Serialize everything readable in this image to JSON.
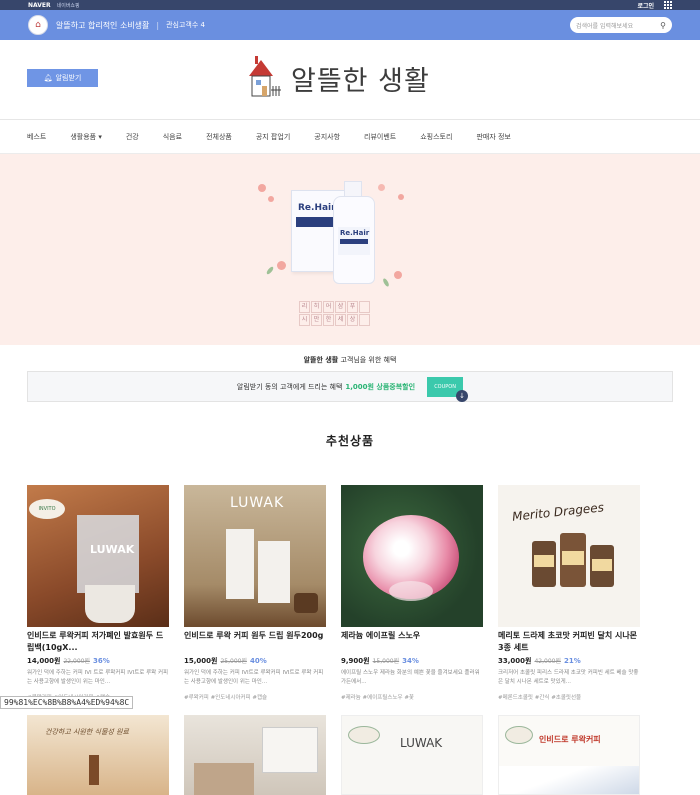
{
  "global": {
    "logo": "NAVER",
    "sub": "네이버쇼핑",
    "login": "로그인"
  },
  "store": {
    "tagline": "알뜰하고 합리적인 소비생활",
    "fans": "관심고객수 4",
    "search_placeholder": "검색어를 입력해보세요"
  },
  "header": {
    "alarm_label": "알림받기",
    "brand_name": "알뜰한 생활"
  },
  "nav": [
    "베스트",
    "생활용품",
    "건강",
    "식음료",
    "전체상품",
    "공지 팝업기",
    "공지사항",
    "리뷰이벤트",
    "쇼핑스토리",
    "판매자 정보"
  ],
  "hero": {
    "product_label": "Re.Hair",
    "tagline_chars": [
      "리",
      "히",
      "어",
      "샴",
      "푸",
      "",
      "시",
      "만",
      "한",
      "세",
      "상",
      ""
    ]
  },
  "benefit": {
    "title_bold": "알뜰한 생활",
    "title_rest": "고객님을 위한 혜택",
    "coupon_text": "알림받기 동의 고객에게 드리는 혜택",
    "coupon_amount": "1,000원 상품중복할인",
    "coupon_badge": "COUPON"
  },
  "recommended_title": "추천상품",
  "products": [
    {
      "title": "인비드로 루왁커피 저가폐인 발효원두 드립백(10gX...",
      "price": "14,000원",
      "orig": "22,000원",
      "disc": "36%",
      "desc": "워가인 덕에 주하는 커피 IVI 트로 루왁커피 IVI트로 루왁 커피는 사용고향에 발생인이 위는 마인...",
      "tags": "#루왁커피 #인도네시아커피 #캡슐",
      "img_label": "LUWAK"
    },
    {
      "title": "인비드로 루왁 커피 원두 드립 원두200g",
      "price": "15,000원",
      "orig": "25,000원",
      "disc": "40%",
      "desc": "워가인 덕에 주하는 커피 IVI트로 루왁커피 IVI트로 루왁 커피는 사용고향에 발생인이 위는 마인...",
      "tags": "#루왁커피 #인도네시아커피 #캡슐",
      "img_label": "LUWAK"
    },
    {
      "title": "제라늄 에이프릴 스노우",
      "price": "9,900원",
      "orig": "15,000원",
      "disc": "34%",
      "desc": "에이프릴 스노우 제라늄 화분의 예쁜 꽃을 즐겨보세요 플러워 가든에서...",
      "tags": "#제라늄 #에이프릴스노우 #꽃",
      "img_label": ""
    },
    {
      "title": "메리토 드라제 초코맛 커피빈 달치 시나몬 3종 세트",
      "price": "33,000원",
      "orig": "42,000원",
      "disc": "21%",
      "desc": "크리저어 초콜릿 피리스 드라제 초코맛 커피빈 세트 베슬 맛좋은 달치 시나몬 세트로 맛있게...",
      "tags": "#메론드초콜릿 #간식 #초콜릿선물",
      "img_label": "Merito Dragees"
    }
  ],
  "products2": [
    {
      "img_label": "건강하고 시원한 식물성 원료"
    },
    {
      "img_label": ""
    },
    {
      "img_label": "LUWAK"
    },
    {
      "img_label": "인비드로 루왁커피"
    }
  ],
  "url_overlay": "99%81%EC%8B%B8%A4%ED%94%8C"
}
